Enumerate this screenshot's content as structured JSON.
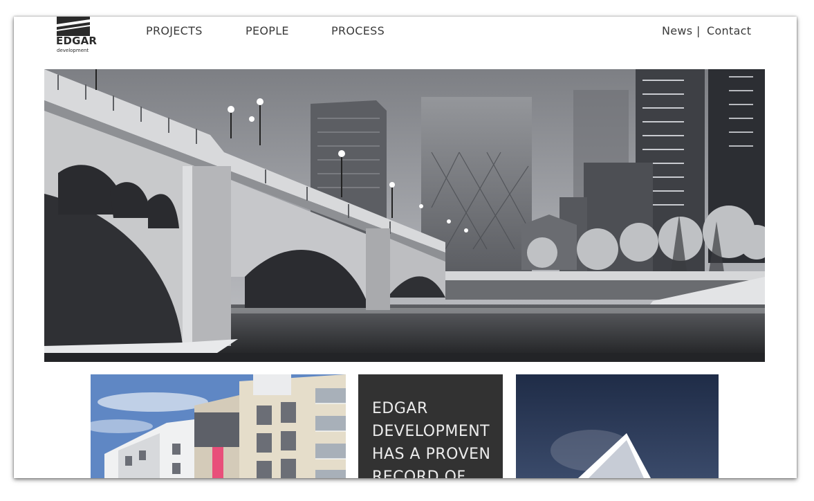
{
  "brand": {
    "name": "EDGAR",
    "tagline": "development"
  },
  "nav": {
    "primary": [
      "PROJECTS",
      "PEOPLE",
      "PROCESS"
    ],
    "secondary": {
      "news": "News",
      "separator": "|",
      "contact": "Contact"
    }
  },
  "feature_text": "EDGAR DEVELOPMENT HAS A PROVEN RECORD OF",
  "colors": {
    "text": "#3a3a3a",
    "dark_tile": "#323232",
    "sky": "#5f87c4",
    "night": "#1f2c47"
  }
}
